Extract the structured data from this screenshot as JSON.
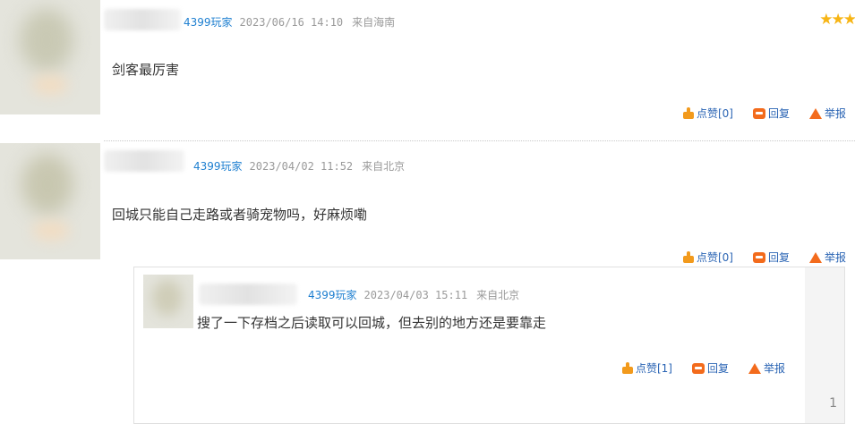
{
  "comments": [
    {
      "user": "4399玩家",
      "time": "2023/06/16 14:10",
      "location": "来自海南",
      "text": "剑客最厉害",
      "like_label": "点赞[0]",
      "reply_label": "回复",
      "report_label": "举报",
      "rating_stars": "★★★"
    },
    {
      "user": "4399玩家",
      "time": "2023/04/02 11:52",
      "location": "来自北京",
      "text": "回城只能自己走路或者骑宠物吗，好麻烦嘞",
      "like_label": "点赞[0]",
      "reply_label": "回复",
      "report_label": "举报",
      "replies": [
        {
          "user": "4399玩家",
          "time": "2023/04/03 15:11",
          "location": "来自北京",
          "text": "搜了一下存档之后读取可以回城，但去别的地方还是要靠走",
          "like_label": "点赞[1]",
          "reply_label": "回复",
          "report_label": "举报",
          "floor": "1"
        }
      ]
    }
  ],
  "colors": {
    "username": "#1e7fd0",
    "meta": "#9a9a9a",
    "link": "#2a64b4",
    "icon_orange": "#f36b1c",
    "star": "#f7b515"
  },
  "icons": [
    "thumb-up-icon",
    "reply-icon",
    "report-icon",
    "star-icon"
  ]
}
